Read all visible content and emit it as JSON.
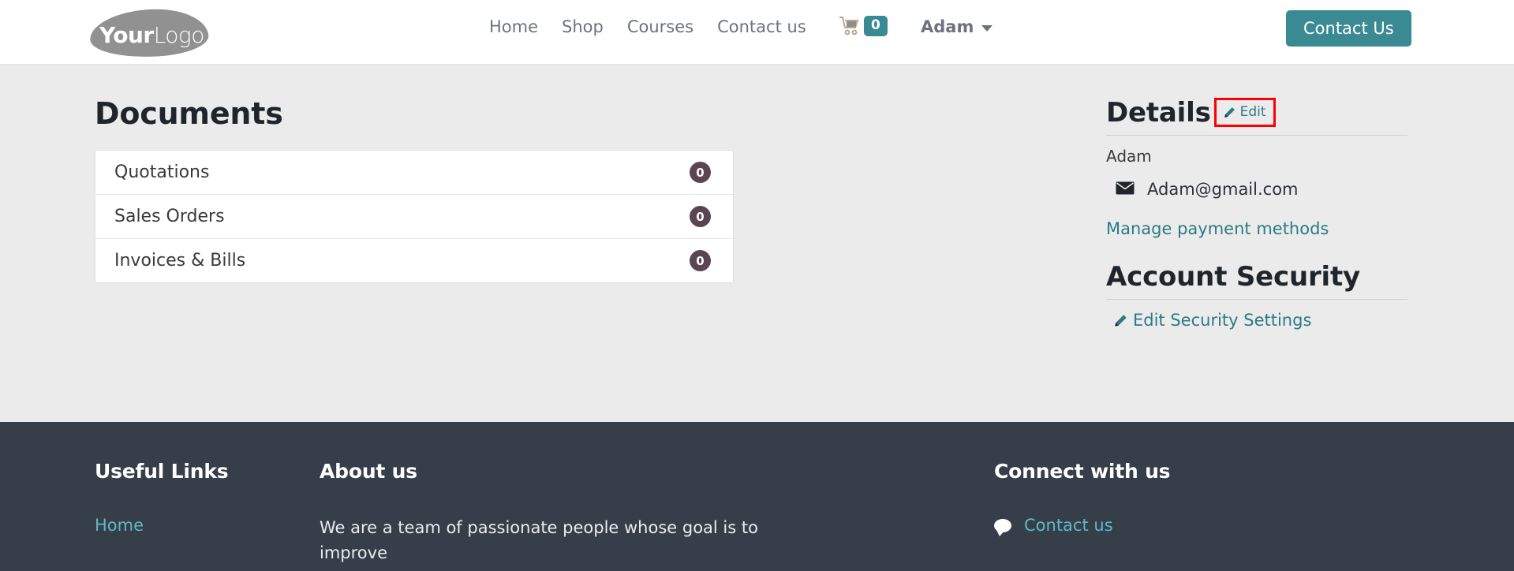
{
  "header": {
    "logo": {
      "bold_part": "Your",
      "light_part": "Logo",
      "icon": "logo-blob"
    },
    "nav": [
      {
        "label": "Home"
      },
      {
        "label": "Shop"
      },
      {
        "label": "Courses"
      },
      {
        "label": "Contact us"
      }
    ],
    "cart": {
      "icon": "shopping-cart-icon",
      "count": "0"
    },
    "user": {
      "name": "Adam",
      "caret_icon": "chevron-down-icon"
    },
    "cta": {
      "label": "Contact Us"
    },
    "colors": {
      "accent": "#3a8a94",
      "nav_text": "#6b7280"
    }
  },
  "main": {
    "documents": {
      "title": "Documents",
      "rows": [
        {
          "label": "Quotations",
          "count": "0"
        },
        {
          "label": "Sales Orders",
          "count": "0"
        },
        {
          "label": "Invoices & Bills",
          "count": "0"
        }
      ],
      "badge_color": "#594650"
    },
    "details": {
      "title": "Details",
      "edit_label": "Edit",
      "edit_icon": "pencil-icon",
      "highlight_color": "#ff0000",
      "name": "Adam",
      "email": "Adam@gmail.com",
      "email_icon": "envelope-icon",
      "manage_payment_label": "Manage payment methods"
    },
    "account_security": {
      "title": "Account Security",
      "edit_settings_label": "Edit Security Settings",
      "edit_settings_icon": "pencil-icon"
    }
  },
  "footer": {
    "background": "#363f49",
    "useful_links": {
      "title": "Useful Links",
      "items": [
        {
          "label": "Home"
        }
      ]
    },
    "about_us": {
      "title": "About us",
      "text": "We are a team of passionate people whose goal is to improve"
    },
    "connect": {
      "title": "Connect with us",
      "contact_label": "Contact us",
      "contact_icon": "speech-bubble-icon"
    },
    "link_color": "#5fb8c4"
  }
}
